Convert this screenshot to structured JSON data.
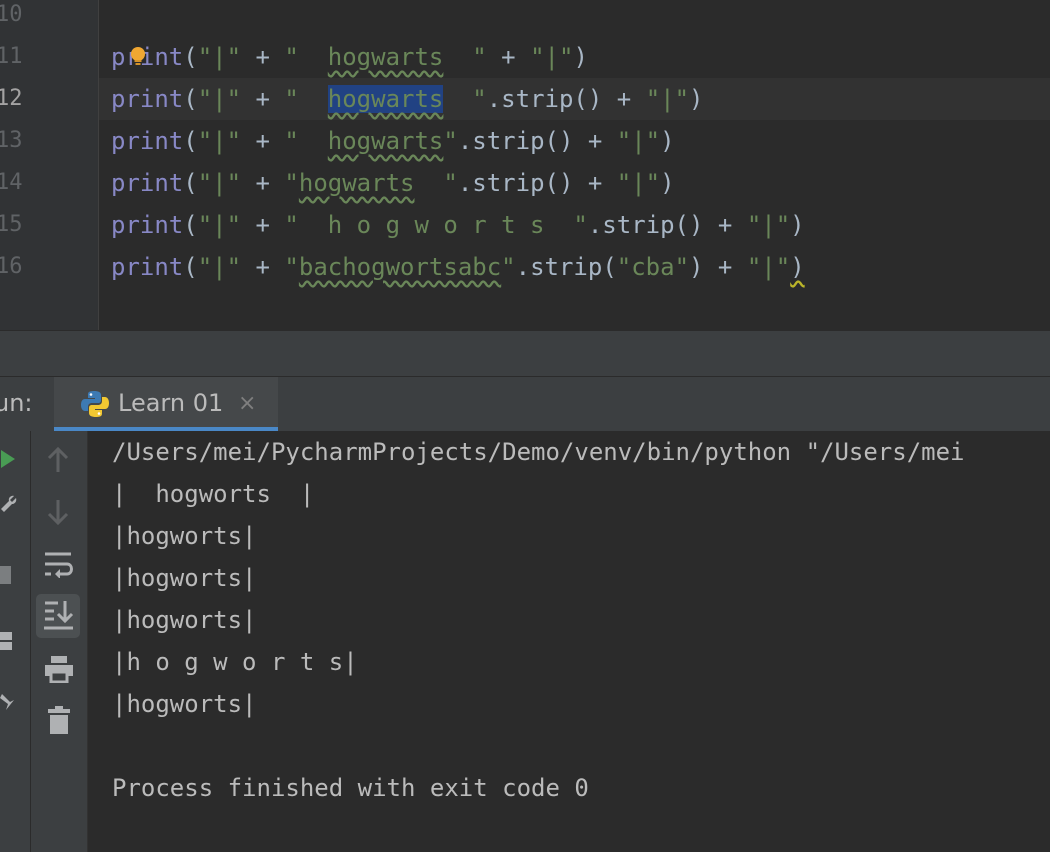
{
  "editor": {
    "line_numbers": [
      "10",
      "11",
      "12",
      "13",
      "14",
      "15",
      "16"
    ],
    "active_line": "12",
    "lines": [
      [
        {
          "t": "print",
          "c": "fn"
        },
        {
          "t": "(",
          "c": "op"
        },
        {
          "t": "\"|\"",
          "c": "str"
        },
        {
          "t": " + ",
          "c": "op"
        },
        {
          "t": "\"  ",
          "c": "str"
        },
        {
          "t": "hogwarts",
          "c": "str typo"
        },
        {
          "t": "  \"",
          "c": "str"
        },
        {
          "t": " + ",
          "c": "op"
        },
        {
          "t": "\"|\"",
          "c": "str"
        },
        {
          "t": ")",
          "c": "op"
        }
      ],
      [
        {
          "t": "print",
          "c": "fn"
        },
        {
          "t": "(",
          "c": "op"
        },
        {
          "t": "\"|\"",
          "c": "str"
        },
        {
          "t": " + ",
          "c": "op"
        },
        {
          "t": "\"  ",
          "c": "str"
        },
        {
          "t": "hogwarts",
          "c": "str typo sel"
        },
        {
          "t": "  \"",
          "c": "str"
        },
        {
          "t": ".strip() + ",
          "c": "op"
        },
        {
          "t": "\"|\"",
          "c": "str"
        },
        {
          "t": ")",
          "c": "op"
        }
      ],
      [
        {
          "t": "print",
          "c": "fn"
        },
        {
          "t": "(",
          "c": "op"
        },
        {
          "t": "\"|\"",
          "c": "str"
        },
        {
          "t": " + ",
          "c": "op"
        },
        {
          "t": "\"  ",
          "c": "str"
        },
        {
          "t": "hogwarts",
          "c": "str typo"
        },
        {
          "t": "\"",
          "c": "str"
        },
        {
          "t": ".strip() + ",
          "c": "op"
        },
        {
          "t": "\"|\"",
          "c": "str"
        },
        {
          "t": ")",
          "c": "op"
        }
      ],
      [
        {
          "t": "print",
          "c": "fn"
        },
        {
          "t": "(",
          "c": "op"
        },
        {
          "t": "\"|\"",
          "c": "str"
        },
        {
          "t": " + ",
          "c": "op"
        },
        {
          "t": "\"",
          "c": "str"
        },
        {
          "t": "hogwarts",
          "c": "str typo"
        },
        {
          "t": "  \"",
          "c": "str"
        },
        {
          "t": ".strip() + ",
          "c": "op"
        },
        {
          "t": "\"|\"",
          "c": "str"
        },
        {
          "t": ")",
          "c": "op"
        }
      ],
      [
        {
          "t": "print",
          "c": "fn"
        },
        {
          "t": "(",
          "c": "op"
        },
        {
          "t": "\"|\"",
          "c": "str"
        },
        {
          "t": " + ",
          "c": "op"
        },
        {
          "t": "\"  h o g w o r t s  \"",
          "c": "str"
        },
        {
          "t": ".strip() + ",
          "c": "op"
        },
        {
          "t": "\"|\"",
          "c": "str"
        },
        {
          "t": ")",
          "c": "op"
        }
      ],
      [
        {
          "t": "print",
          "c": "fn"
        },
        {
          "t": "(",
          "c": "op"
        },
        {
          "t": "\"|\"",
          "c": "str"
        },
        {
          "t": " + ",
          "c": "op"
        },
        {
          "t": "\"",
          "c": "str"
        },
        {
          "t": "bachogwortsabc",
          "c": "str typo"
        },
        {
          "t": "\"",
          "c": "str"
        },
        {
          "t": ".strip(",
          "c": "op"
        },
        {
          "t": "\"cba\"",
          "c": "str"
        },
        {
          "t": ") + ",
          "c": "op"
        },
        {
          "t": "\"|\"",
          "c": "str"
        },
        {
          "t": ")",
          "c": "op warn-wave"
        }
      ]
    ]
  },
  "run_panel": {
    "label": "un:",
    "tab_title": "Learn 01",
    "tab_close": "×"
  },
  "console": {
    "lines": [
      "/Users/mei/PycharmProjects/Demo/venv/bin/python \"/Users/mei",
      "|  hogworts  |",
      "|hogworts|",
      "|hogworts|",
      "|hogworts|",
      "|h o g w o r t s|",
      "|hogworts|",
      "",
      "Process finished with exit code 0"
    ]
  },
  "toolbar_icons": {
    "left": [
      "run-icon",
      "wrench-icon",
      "stop-icon",
      "layout-icon",
      "pin-icon"
    ],
    "right": [
      "arrow-up-icon",
      "arrow-down-icon",
      "soft-wrap-icon",
      "scroll-to-end-icon",
      "print-icon",
      "trash-icon"
    ]
  },
  "colors": {
    "keyword_builtin": "#8888c6",
    "string": "#6a8759",
    "selection": "#214283",
    "run_green": "#499c54",
    "bulb": "#f0a732"
  }
}
